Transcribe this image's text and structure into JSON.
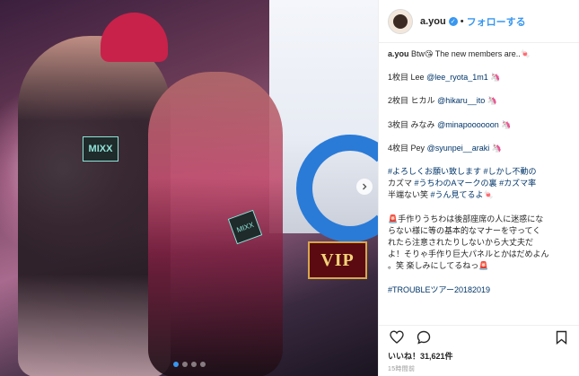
{
  "post": {
    "username": "a.you",
    "separator": "•",
    "follow_label": "フォローする"
  },
  "photo": {
    "vip_sign": "VIP",
    "badge_left": "MIXX",
    "badge_right": "MIXX",
    "carousel_dots": 4,
    "active_dot": 0
  },
  "caption": {
    "lines": [
      {
        "user": "a.you",
        "text": " Btw😘 The new members are..🍬"
      },
      {
        "text": ""
      },
      {
        "text": "1枚目 Lee @lee_ryota_1m1 🦄"
      },
      {
        "text": ""
      },
      {
        "text": "2枚目 ヒカル @hikaru__ito 🦄"
      },
      {
        "text": ""
      },
      {
        "text": "3枚目 みなみ @minapoooooon 🦄"
      },
      {
        "text": ""
      },
      {
        "text": "4枚目 Pey @syunpei__araki 🦄"
      },
      {
        "text": ""
      },
      {
        "text": "#よろしくお願い致します #しかし不動の"
      },
      {
        "text": "カズマ #うちわのAマークの裏 #カズマ率"
      },
      {
        "text": "半端ない笑 #うん見てるよ🍬"
      },
      {
        "text": ""
      },
      {
        "text": "🚨手作りうちわは後部座席の人に迷惑にな"
      },
      {
        "text": "らない様に等の基本的なマナーを守ってく"
      },
      {
        "text": "れたら注意されたりしないから大丈夫だ"
      },
      {
        "text": "よ！そりゃ手作り巨大パネルとかはだめよん"
      },
      {
        "text": "。笑 楽しみにしてるねっ🚨"
      },
      {
        "text": ""
      },
      {
        "text": "#TROUBLEツアー20182019"
      }
    ]
  },
  "actions": {
    "like_icon": "heart-icon",
    "comment_icon": "comment-icon",
    "save_icon": "bookmark-icon"
  },
  "likes_text": "いいね！31,621件",
  "timestamp": "15時間前",
  "colors": {
    "link": "#3897f0",
    "hashtag": "#003569",
    "text": "#262626",
    "muted": "#999999"
  }
}
